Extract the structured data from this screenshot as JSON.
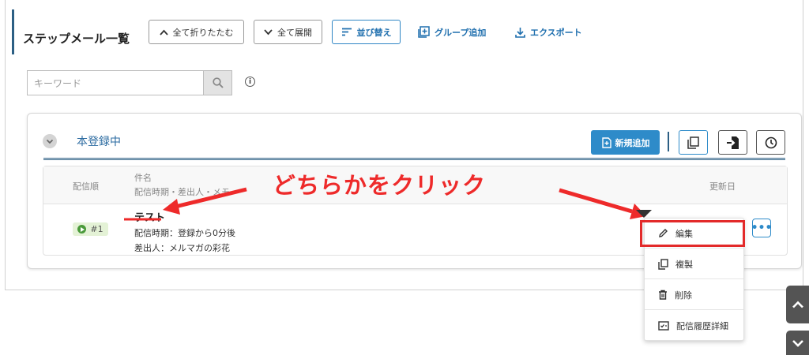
{
  "header": {
    "title": "ステップメール一覧",
    "collapse_all": "全て折りたたむ",
    "expand_all": "全て展開",
    "sort": "並び替え",
    "add_group": "グループ追加",
    "export": "エクスポート"
  },
  "search": {
    "placeholder": "キーワード"
  },
  "group": {
    "name": "本登録中",
    "new_button": "新規追加"
  },
  "table": {
    "columns": {
      "order": "配信順",
      "subject": "件名",
      "subject_sub": "配信時期・差出人・メモ",
      "updated": "更新日"
    },
    "rows": [
      {
        "order": "#1",
        "title": "テスト",
        "timing": "配信時期：登録から0分後",
        "sender": "差出人：メルマガの彩花"
      }
    ]
  },
  "annotation": {
    "text": "どちらかをクリック"
  },
  "menu": {
    "items": [
      {
        "label": "編集",
        "icon": "pencil-icon"
      },
      {
        "label": "複製",
        "icon": "copy-icon"
      },
      {
        "label": "削除",
        "icon": "trash-icon"
      },
      {
        "label": "配信履歴詳細",
        "icon": "history-detail-icon"
      }
    ]
  },
  "colors": {
    "accent": "#2e8bc9",
    "annotation": "#ee2a2a",
    "badge_bg": "#e4f2d6"
  }
}
